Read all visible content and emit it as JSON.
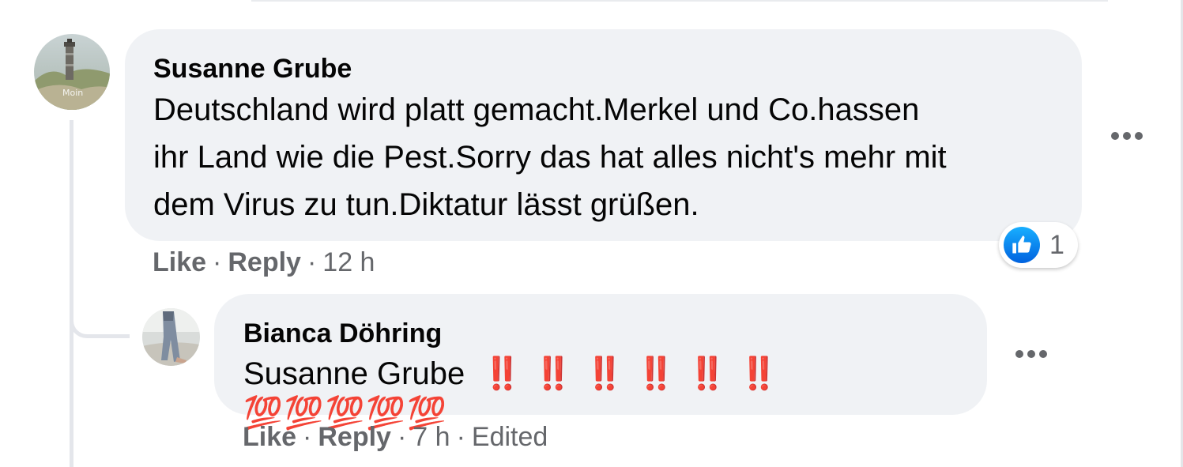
{
  "comments": [
    {
      "author": "Susanne Grube",
      "text": "Deutschland wird platt gemacht.Merkel und Co.hassen\nihr Land wie die Pest.Sorry das hat alles nicht's mehr mit\ndem Virus zu tun.Diktatur lässt grüßen.",
      "avatar_label": "Moin",
      "like_label": "Like",
      "reply_label": "Reply",
      "time": "12 h",
      "reaction_count": "1",
      "reaction_icon": "like-icon"
    },
    {
      "author": "Bianca Döhring",
      "mention": "Susanne Grube",
      "emojis": "‼️ ‼️ ‼️ ‼️ ‼️ ‼️ 💯💯💯💯💯",
      "like_label": "Like",
      "reply_label": "Reply",
      "time": "7 h",
      "edited_label": "Edited"
    }
  ],
  "colors": {
    "bubble_bg": "#f0f2f5",
    "meta_text": "#65676b",
    "like_blue": "#1877f2",
    "emoji_red": "#d81f26"
  }
}
